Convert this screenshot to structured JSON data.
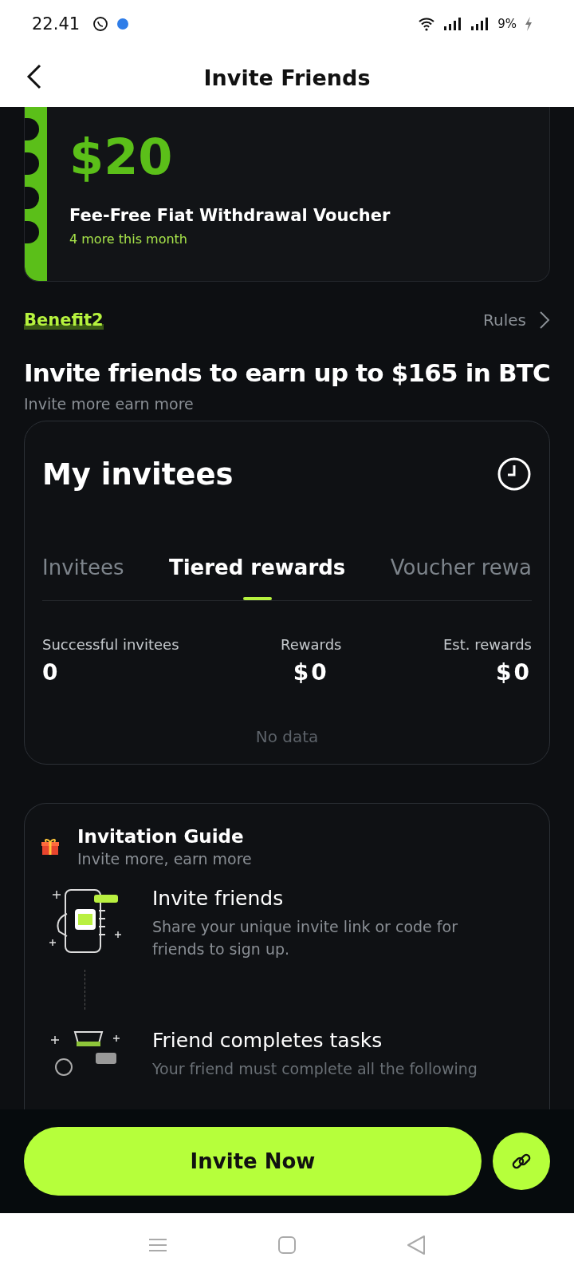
{
  "status_bar": {
    "time": "22.41",
    "battery": "9%"
  },
  "header": {
    "title": "Invite Friends"
  },
  "voucher": {
    "amount": "$20",
    "title": "Fee-Free Fiat Withdrawal Voucher",
    "note": "4 more this month"
  },
  "benefit": {
    "label": "Benefit2",
    "rules": "Rules",
    "headline": "Invite friends to earn up to $165 in BTC",
    "subtitle": "Invite more earn more"
  },
  "invitees": {
    "title": "My invitees",
    "tabs": [
      {
        "label": "Invitees",
        "selected": false
      },
      {
        "label": "Tiered rewards",
        "selected": true
      },
      {
        "label": "Voucher rewa",
        "selected": false
      }
    ],
    "stats": [
      {
        "label": "Successful invitees",
        "value": "0"
      },
      {
        "label": "Rewards",
        "value": "$0"
      },
      {
        "label": "Est. rewards",
        "value": "$0"
      }
    ],
    "empty": "No data"
  },
  "guide": {
    "title": "Invitation Guide",
    "subtitle": "Invite more, earn more",
    "steps": [
      {
        "kind": "phone",
        "title": "Invite friends",
        "text": "Share your unique invite link or code for friends to sign up."
      },
      {
        "kind": "bag",
        "title": "Friend completes tasks",
        "text": "Your friend must complete all the following"
      }
    ]
  },
  "footer": {
    "button": "Invite Now"
  }
}
